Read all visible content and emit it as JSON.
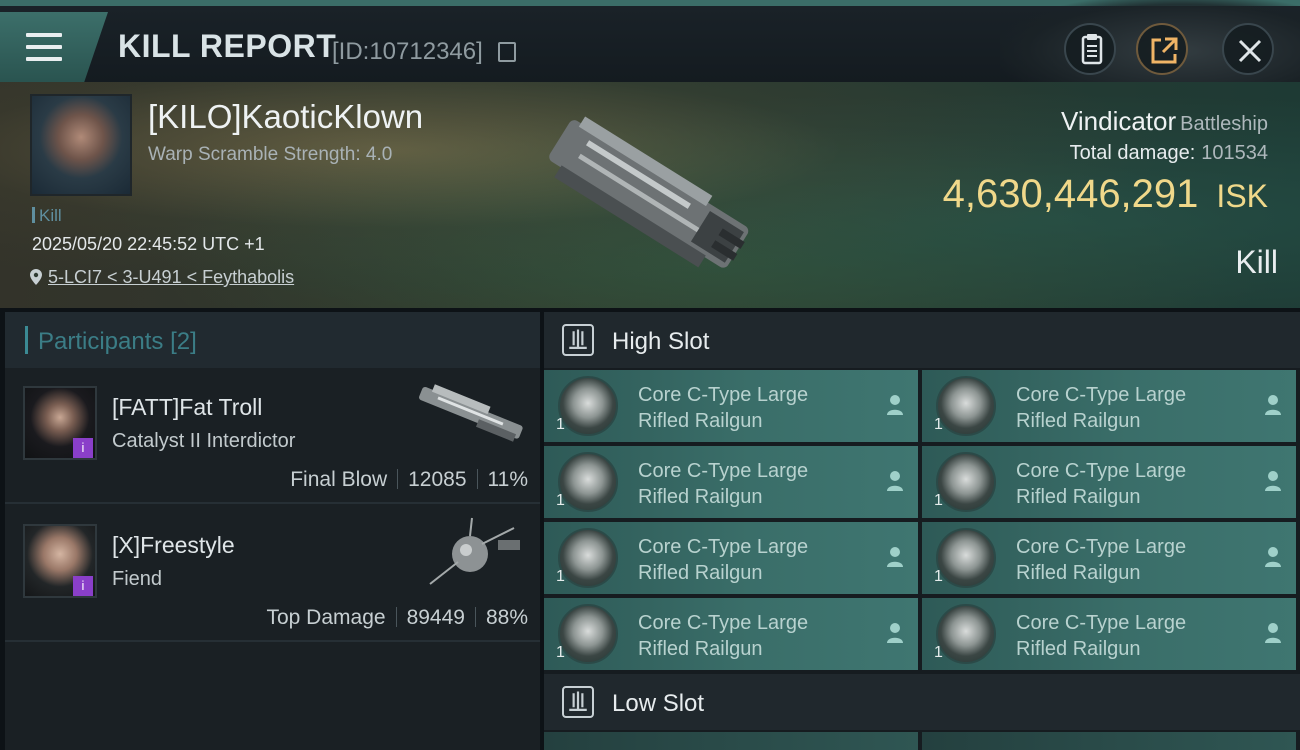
{
  "header": {
    "title": "KILL REPORT",
    "report_id": "[ID:10712346]"
  },
  "victim": {
    "name": "[KILO]KaoticKlown",
    "scramble": "Warp Scramble Strength: 4.0",
    "tag": "Kill",
    "datetime": "2025/05/20 22:45:52 UTC +1",
    "location": "5-LCI7 < 3-U491 < Feythabolis",
    "ship_name": "Vindicator",
    "ship_class": "Battleship",
    "total_damage_label": "Total damage:",
    "total_damage": "101534",
    "isk_value": "4,630,446,291",
    "isk_unit": "ISK",
    "result": "Kill"
  },
  "participants": {
    "label": "Participants",
    "count": "[2]",
    "rows": [
      {
        "name": "[FATT]Fat Troll",
        "ship": "Catalyst II Interdictor",
        "role": "Final Blow",
        "damage": "12085",
        "percent": "11%"
      },
      {
        "name": "[X]Freestyle",
        "ship": "Fiend",
        "role": "Top Damage",
        "damage": "89449",
        "percent": "88%"
      }
    ]
  },
  "slots": {
    "high_label": "High Slot",
    "low_label": "Low Slot",
    "high_modules": [
      {
        "line1": "Core C-Type Large",
        "line2": "Rifled Railgun",
        "qty": "1"
      },
      {
        "line1": "Core C-Type Large",
        "line2": "Rifled Railgun",
        "qty": "1"
      },
      {
        "line1": "Core C-Type Large",
        "line2": "Rifled Railgun",
        "qty": "1"
      },
      {
        "line1": "Core C-Type Large",
        "line2": "Rifled Railgun",
        "qty": "1"
      },
      {
        "line1": "Core C-Type Large",
        "line2": "Rifled Railgun",
        "qty": "1"
      },
      {
        "line1": "Core C-Type Large",
        "line2": "Rifled Railgun",
        "qty": "1"
      },
      {
        "line1": "Core C-Type Large",
        "line2": "Rifled Railgun",
        "qty": "1"
      },
      {
        "line1": "Core C-Type Large",
        "line2": "Rifled Railgun",
        "qty": "1"
      }
    ]
  },
  "colors": {
    "accent": "#3b6d68",
    "isk_gold": "#f0d88a",
    "module_bg": "#3a6e69",
    "badge_purple": "#8a3fc9"
  }
}
